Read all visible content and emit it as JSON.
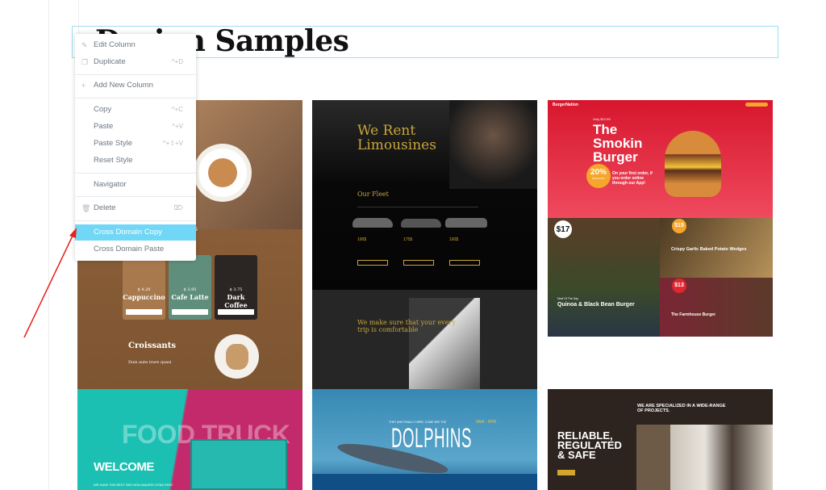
{
  "heading": "Design Samples",
  "context_menu": {
    "items": [
      {
        "label": "Edit Column",
        "icon": "pencil-icon",
        "shortcut": ""
      },
      {
        "label": "Duplicate",
        "icon": "duplicate-icon",
        "shortcut": "^+D"
      },
      {
        "label": "Add New Column",
        "icon": "plus-icon",
        "shortcut": ""
      },
      {
        "label": "Copy",
        "icon": "",
        "shortcut": "^+C"
      },
      {
        "label": "Paste",
        "icon": "",
        "shortcut": "^+V"
      },
      {
        "label": "Paste Style",
        "icon": "",
        "shortcut": "^+⇧+V"
      },
      {
        "label": "Reset Style",
        "icon": "",
        "shortcut": ""
      },
      {
        "label": "Navigator",
        "icon": "",
        "shortcut": ""
      },
      {
        "label": "Delete",
        "icon": "trash-icon",
        "shortcut": "⌦"
      },
      {
        "label": "Cross Domain Copy",
        "icon": "",
        "shortcut": "",
        "highlighted": true
      },
      {
        "label": "Cross Domain Paste",
        "icon": "",
        "shortcut": ""
      }
    ],
    "highlight_color": "#71d7f7"
  },
  "annotation": {
    "arrow_color": "#e8201c"
  },
  "thumbnails": {
    "coffee": {
      "section": "ks",
      "cards": [
        {
          "price": "$ 4.20",
          "name": "Cappuccino",
          "btn": "Get Delivery"
        },
        {
          "price": "$ 3.95",
          "name": "Cafe Latte",
          "btn": "Get Delivery"
        },
        {
          "price": "$ 3.75",
          "name": "Dark Coffee",
          "btn": "Get Delivery"
        }
      ],
      "croissants": "Croissants",
      "croissants_sub": "Duis aute irure quasi"
    },
    "food_truck": {
      "title": "FOOD TRUCK",
      "welcome": "WELCOME",
      "tagline": "WE HAVE THE BEST SED NON MAURIS VITAE ERAT"
    },
    "limo": {
      "title1": "We Rent",
      "title2": "Limousines",
      "fleet": "Our Fleet",
      "prices": [
        "190$",
        "175$",
        "160$"
      ],
      "comfort": "We make sure that your every trip is comfortable"
    },
    "dolphins": {
      "tag": "THEY ARE FINALLY HERE, COME SEE THE",
      "title": "DOLPHINS",
      "hours": "9AM - 9PM"
    },
    "burger": {
      "brand": "BurgerNation",
      "promo": "Only $12.99",
      "title": "The Smokin Burger",
      "discount": "20%",
      "discount_label": "DISCOUNT",
      "offer": "On your first order, if you order online through our App!",
      "price1": "$17",
      "price2": "$15",
      "price3": "$13",
      "only": "only",
      "item1": "Quinoa & Black Bean Burger",
      "item1_tag": "Deal Of The Day",
      "item2": "Crispy Garlic Baked Potato Wedges",
      "item3": "The Farmhouse Burger"
    },
    "construction": {
      "headline": "WE ARE SPECIALIZED IN A WIDE-RANGE OF PROJECTS.",
      "title": "RELIABLE, REGULATED & SAFE"
    }
  }
}
